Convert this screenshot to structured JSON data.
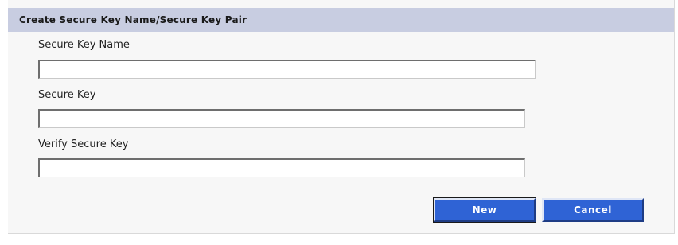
{
  "dialog": {
    "title": "Create Secure Key Name/Secure Key Pair"
  },
  "fields": {
    "secure_key_name": {
      "label": "Secure Key Name",
      "value": "",
      "placeholder": ""
    },
    "secure_key": {
      "label": "Secure Key",
      "value": "",
      "placeholder": ""
    },
    "verify_secure_key": {
      "label": "Verify Secure Key",
      "value": "",
      "placeholder": ""
    }
  },
  "buttons": {
    "new_label": "New",
    "cancel_label": "Cancel"
  },
  "colors": {
    "header_bg": "#c8cde1",
    "panel_bg": "#f7f7f7",
    "button_bg": "#2f63d5",
    "button_text": "#ffffff"
  }
}
